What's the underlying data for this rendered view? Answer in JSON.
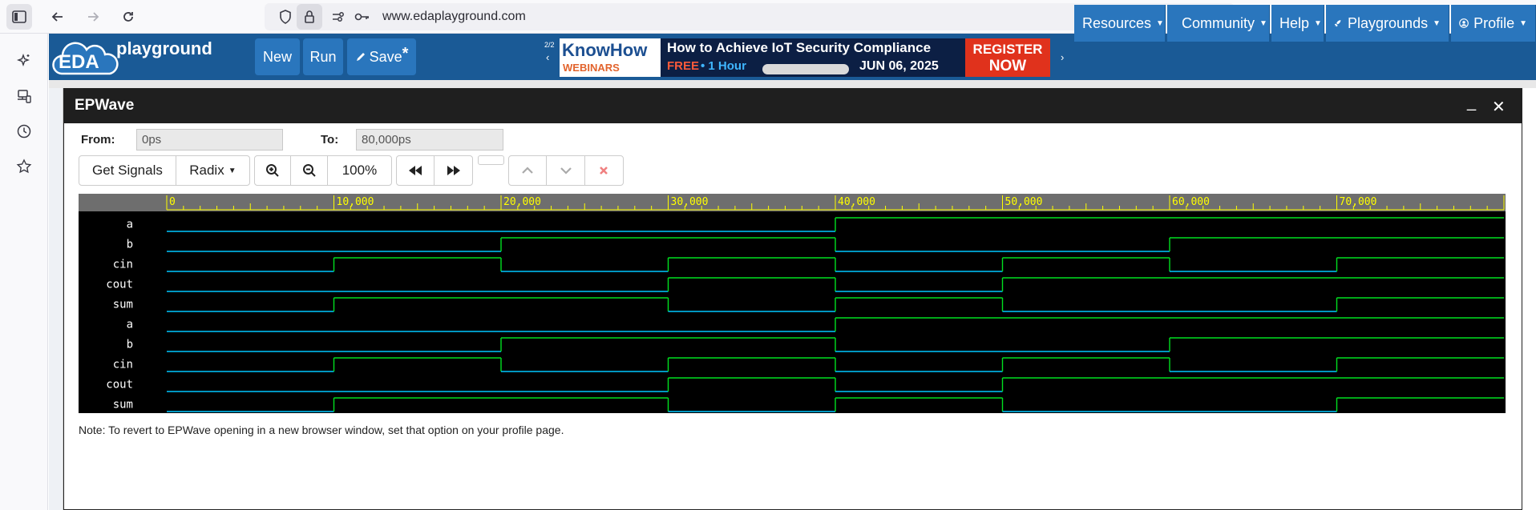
{
  "browser": {
    "url": "www.edaplayground.com"
  },
  "nav": {
    "logo_eda": "EDA",
    "logo_playground": "playground",
    "new_label": "New",
    "run_label": "Run",
    "save_label": "Save",
    "save_mark": "*",
    "ad_counter": "2/2",
    "ad": {
      "brand_top": "KnowHow",
      "brand_bottom": "WEBINARS",
      "headline": "How to Achieve IoT Security Compliance",
      "free": "FREE",
      "duration": "• 1 Hour",
      "date": "JUN 06, 2025",
      "cta_top": "REGISTER",
      "cta_bottom": "NOW"
    },
    "menu": [
      {
        "label": "Resources"
      },
      {
        "label": "Community"
      },
      {
        "label": "Help"
      },
      {
        "label": "Playgrounds"
      },
      {
        "label": "Profile"
      }
    ]
  },
  "modal": {
    "title": "EPWave",
    "from_label": "From:",
    "from_value": "0ps",
    "to_label": "To:",
    "to_value": "80,000ps",
    "get_signals": "Get Signals",
    "radix": "Radix",
    "zoom": "100%",
    "note": "Note: To revert to EPWave opening in a new browser window, set that option on your profile page."
  },
  "waveform": {
    "time_range": [
      0,
      80000
    ],
    "tick_labels": [
      "0",
      "10,000",
      "20,000",
      "30,000",
      "40,000",
      "50,000",
      "60,000",
      "70,000"
    ],
    "colors": {
      "low": "#00c8ff",
      "high": "#00e020",
      "axis_text": "#ffff00",
      "label": "#ffffff"
    },
    "signals": [
      {
        "name": "a",
        "transitions": [
          [
            0,
            0
          ],
          [
            40000,
            1
          ]
        ]
      },
      {
        "name": "b",
        "transitions": [
          [
            0,
            0
          ],
          [
            20000,
            1
          ],
          [
            40000,
            0
          ],
          [
            60000,
            1
          ]
        ]
      },
      {
        "name": "cin",
        "transitions": [
          [
            0,
            0
          ],
          [
            10000,
            1
          ],
          [
            20000,
            0
          ],
          [
            30000,
            1
          ],
          [
            40000,
            0
          ],
          [
            50000,
            1
          ],
          [
            60000,
            0
          ],
          [
            70000,
            1
          ]
        ]
      },
      {
        "name": "cout",
        "transitions": [
          [
            0,
            0
          ],
          [
            30000,
            1
          ],
          [
            40000,
            0
          ],
          [
            50000,
            1
          ]
        ]
      },
      {
        "name": "sum",
        "transitions": [
          [
            0,
            0
          ],
          [
            10000,
            1
          ],
          [
            30000,
            0
          ],
          [
            40000,
            1
          ],
          [
            50000,
            0
          ],
          [
            70000,
            1
          ]
        ]
      },
      {
        "name": "a",
        "transitions": [
          [
            0,
            0
          ],
          [
            40000,
            1
          ]
        ]
      },
      {
        "name": "b",
        "transitions": [
          [
            0,
            0
          ],
          [
            20000,
            1
          ],
          [
            40000,
            0
          ],
          [
            60000,
            1
          ]
        ]
      },
      {
        "name": "cin",
        "transitions": [
          [
            0,
            0
          ],
          [
            10000,
            1
          ],
          [
            20000,
            0
          ],
          [
            30000,
            1
          ],
          [
            40000,
            0
          ],
          [
            50000,
            1
          ],
          [
            60000,
            0
          ],
          [
            70000,
            1
          ]
        ]
      },
      {
        "name": "cout",
        "transitions": [
          [
            0,
            0
          ],
          [
            30000,
            1
          ],
          [
            40000,
            0
          ],
          [
            50000,
            1
          ]
        ]
      },
      {
        "name": "sum",
        "transitions": [
          [
            0,
            0
          ],
          [
            10000,
            1
          ],
          [
            30000,
            0
          ],
          [
            40000,
            1
          ],
          [
            50000,
            0
          ],
          [
            70000,
            1
          ]
        ]
      }
    ]
  }
}
